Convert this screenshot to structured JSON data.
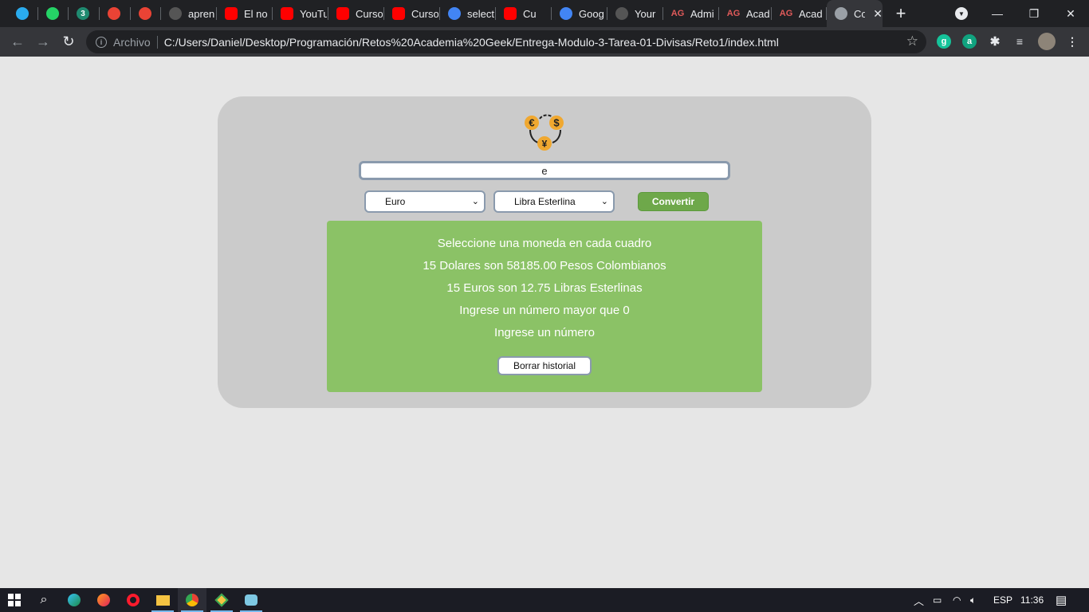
{
  "browser": {
    "tabs": [
      {
        "label": "",
        "icon": "telegram-icon",
        "color": "#2aabee"
      },
      {
        "label": "",
        "icon": "whatsapp-icon",
        "color": "#25d366"
      },
      {
        "label": "",
        "icon_text": "3",
        "icon": "badge-3-icon",
        "color": "#1f8a70"
      },
      {
        "label": "",
        "icon": "gmail-icon",
        "color": "#ea4335"
      },
      {
        "label": "",
        "icon": "gmail-icon",
        "color": "#ea4335"
      },
      {
        "label": "apren",
        "icon": "github-icon",
        "color": "#555"
      },
      {
        "label": "El no",
        "icon": "youtube-icon",
        "color": "#ff0000"
      },
      {
        "label": "YouTu",
        "icon": "youtube-icon",
        "color": "#ff0000"
      },
      {
        "label": "Curso",
        "icon": "youtube-icon",
        "color": "#ff0000"
      },
      {
        "label": "Curso",
        "icon": "youtube-icon",
        "color": "#ff0000"
      },
      {
        "label": "select",
        "icon": "google-icon",
        "color": "#4285f4"
      },
      {
        "label": "Cu",
        "icon": "youtube-icon",
        "color": "#ff0000"
      },
      {
        "label": "Goog",
        "icon": "google-translate-icon",
        "color": "#4285f4"
      },
      {
        "label": "Your",
        "icon": "github-icon",
        "color": "#555"
      },
      {
        "label": "Admi",
        "icon_text": "AG",
        "icon": "ag-icon",
        "color": "#e05a5a"
      },
      {
        "label": "Acad",
        "icon_text": "AG",
        "icon": "ag-icon",
        "color": "#e05a5a"
      },
      {
        "label": "Acad",
        "icon_text": "AG",
        "icon": "ag-icon",
        "color": "#e05a5a"
      },
      {
        "label": "Co",
        "icon": "globe-icon",
        "color": "#9aa0a6",
        "active": true
      }
    ],
    "address": {
      "scheme_label": "Archivo",
      "url": "C:/Users/Daniel/Desktop/Programación/Retos%20Academia%20Geek/Entrega-Modulo-3-Tarea-01-Divisas/Reto1/index.html"
    }
  },
  "converter": {
    "amount_value": "e",
    "from_currency": "Euro",
    "to_currency": "Libra Esterlina",
    "convert_label": "Convertir",
    "messages": [
      "Seleccione una moneda en cada cuadro",
      "15 Dolares son 58185.00 Pesos Colombianos",
      "15 Euros son 12.75 Libras Esterlinas",
      "Ingrese un número mayor que 0",
      "Ingrese un número"
    ],
    "clear_label": "Borrar historial",
    "logo_symbols": [
      "€",
      "$",
      "¥"
    ],
    "colors": {
      "card": "#cbcbcb",
      "results": "#8bc266",
      "convert_button": "#6ea84a",
      "coin": "#f0a830"
    }
  },
  "taskbar": {
    "language": "ESP",
    "time": "11:36"
  }
}
